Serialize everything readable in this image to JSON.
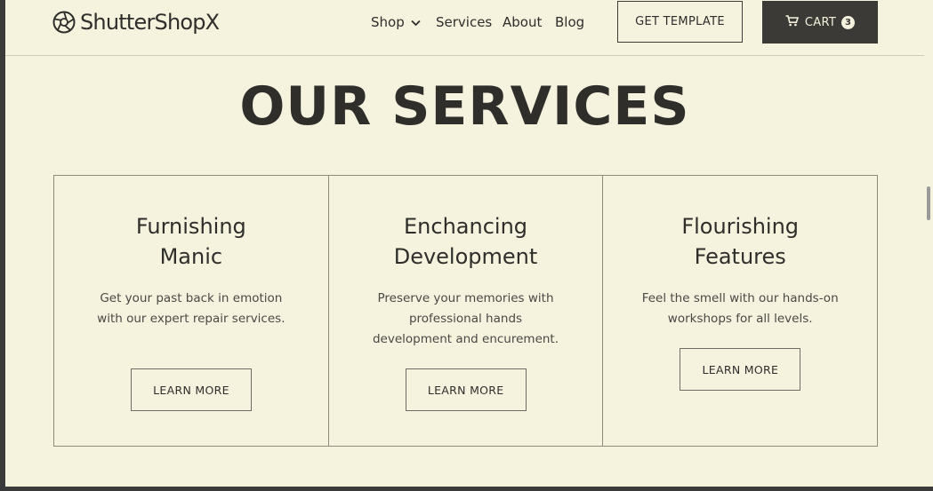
{
  "brand": {
    "name": "ShutterShopX",
    "logo_icon": "camera-aperture-icon"
  },
  "nav": {
    "items": [
      {
        "label": "Shop",
        "icon": "chevron-down-icon"
      },
      {
        "label": "Services"
      },
      {
        "label": "About"
      },
      {
        "label": "Blog"
      }
    ]
  },
  "header": {
    "template_button": "GET TEMPLATE",
    "cart_label": "CART",
    "cart_icon": "shopping-cart-icon",
    "cart_count": "3"
  },
  "section": {
    "title": "OUR SERVICES"
  },
  "services": [
    {
      "title_line1": "Furnishing",
      "title_line2": "Manic",
      "description": "Get your past back in emotion with our expert repair services.",
      "button": "LEARN MORE"
    },
    {
      "title_line1": "Enchancing",
      "title_line2": "Development",
      "description": "Preserve your memories with professional hands development and encurement.",
      "button": "LEARN MORE"
    },
    {
      "title_line1": "Flourishing",
      "title_line2": "Features",
      "description": "Feel the smell with our hands-on workshops for all levels.",
      "button": "LEARN MORE"
    }
  ],
  "colors": {
    "background": "#f5f2de",
    "text": "#2f2e2b",
    "cart_button": "#3b3a37",
    "border": "#8f8c7e"
  }
}
